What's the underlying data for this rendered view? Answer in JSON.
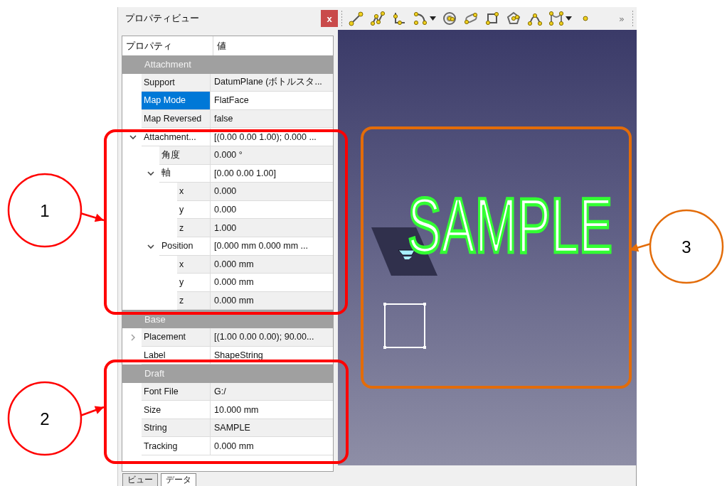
{
  "panel": {
    "title": "プロパティビュー",
    "close": "x",
    "columns": [
      "プロパティ",
      "値"
    ],
    "groups": [
      {
        "name": "Attachment",
        "properties": [
          {
            "label": "Support",
            "value": "DatumPlane (ボトルスタ...",
            "selected": false
          },
          {
            "label": "Map Mode",
            "value": "FlatFace",
            "selected": true
          },
          {
            "label": "Map Reversed",
            "value": "false",
            "selected": false
          },
          {
            "label": "Attachment...",
            "value": "[(0.00 0.00 1.00); 0.000 ...",
            "selected": false,
            "expanded": true,
            "children": [
              {
                "label": "角度",
                "value": "0.000 °",
                "selected": false
              },
              {
                "label": "軸",
                "value": "[0.00 0.00 1.00]",
                "selected": false,
                "expanded": true,
                "children": [
                  {
                    "label": "x",
                    "value": "0.000",
                    "selected": false
                  },
                  {
                    "label": "y",
                    "value": "0.000",
                    "selected": false
                  },
                  {
                    "label": "z",
                    "value": "1.000",
                    "selected": false
                  }
                ]
              },
              {
                "label": "Position",
                "value": "[0.000 mm  0.000 mm  ...",
                "selected": false,
                "expanded": true,
                "children": [
                  {
                    "label": "x",
                    "value": "0.000 mm",
                    "selected": false
                  },
                  {
                    "label": "y",
                    "value": "0.000 mm",
                    "selected": false
                  },
                  {
                    "label": "z",
                    "value": "0.000 mm",
                    "selected": false
                  }
                ]
              }
            ]
          }
        ]
      },
      {
        "name": "Base",
        "properties": [
          {
            "label": "Placement",
            "value": "[(1.00 0.00 0.00); 90.00...",
            "selected": false,
            "expanded": false
          },
          {
            "label": "Label",
            "value": "ShapeString",
            "selected": false
          }
        ]
      },
      {
        "name": "Draft",
        "properties": [
          {
            "label": "Font File",
            "value": "G:/",
            "selected": false
          },
          {
            "label": "Size",
            "value": "10.000 mm",
            "selected": false
          },
          {
            "label": "String",
            "value": "SAMPLE",
            "selected": false
          },
          {
            "label": "Tracking",
            "value": "0.000 mm",
            "selected": false
          }
        ]
      }
    ],
    "tabs": [
      {
        "label": "ビュー",
        "selected": false
      },
      {
        "label": "データ",
        "selected": true
      }
    ]
  },
  "toolbar": {
    "overflow": "»"
  },
  "viewport": {
    "shape_text": "SAMPLE"
  },
  "callouts": [
    {
      "number": "1",
      "color": "#ff0000"
    },
    {
      "number": "2",
      "color": "#ff0000"
    },
    {
      "number": "3",
      "color": "#e36c09"
    }
  ]
}
